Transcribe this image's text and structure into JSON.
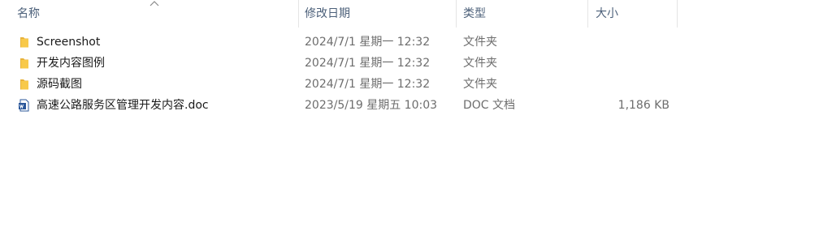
{
  "columns": {
    "name": "名称",
    "date": "修改日期",
    "type": "类型",
    "size": "大小"
  },
  "sort_indicator": "chevron-up-icon",
  "files": [
    {
      "name": "Screenshot",
      "date": "2024/7/1 星期一 12:32",
      "type": "文件夹",
      "size": "",
      "icon": "folder-icon"
    },
    {
      "name": "开发内容图例",
      "date": "2024/7/1 星期一 12:32",
      "type": "文件夹",
      "size": "",
      "icon": "folder-icon"
    },
    {
      "name": "源码截图",
      "date": "2024/7/1 星期一 12:32",
      "type": "文件夹",
      "size": "",
      "icon": "folder-icon"
    },
    {
      "name": "高速公路服务区管理开发内容.doc",
      "date": "2023/5/19 星期五 10:03",
      "type": "DOC 文档",
      "size": "1,186 KB",
      "icon": "word-document-icon"
    }
  ],
  "colors": {
    "header_text": "#4c607a",
    "folder_yellow": "#f8c94a",
    "word_blue": "#2b579a"
  }
}
